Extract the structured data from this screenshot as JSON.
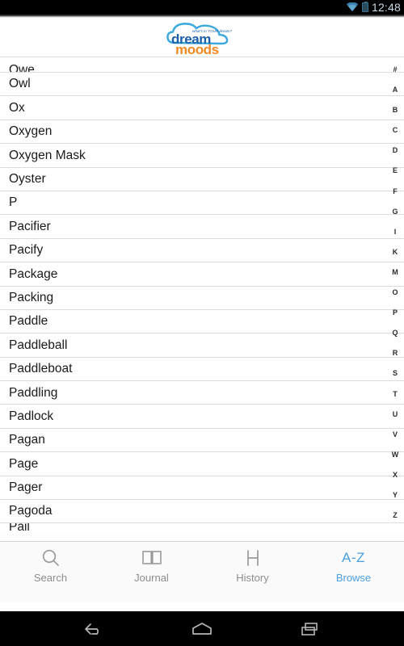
{
  "status_bar": {
    "time": "12:48",
    "wifi_icon": "wifi-icon",
    "battery_icon": "battery-icon"
  },
  "brand": {
    "tagline": "what's in YOUR dream?",
    "name_top": "dream",
    "name_bottom": "moods",
    "color_blue": "#1d5fa8",
    "color_orange": "#f08a24",
    "cloud_color": "#3ba9dd"
  },
  "list": {
    "items": [
      {
        "word": "Owe",
        "clipped": "top"
      },
      {
        "word": "Owl"
      },
      {
        "word": "Ox"
      },
      {
        "word": "Oxygen"
      },
      {
        "word": "Oxygen Mask"
      },
      {
        "word": "Oyster"
      },
      {
        "word": "P"
      },
      {
        "word": "Pacifier"
      },
      {
        "word": "Pacify"
      },
      {
        "word": "Package"
      },
      {
        "word": "Packing"
      },
      {
        "word": "Paddle"
      },
      {
        "word": "Paddleball"
      },
      {
        "word": "Paddleboat"
      },
      {
        "word": "Paddling"
      },
      {
        "word": "Padlock"
      },
      {
        "word": "Pagan"
      },
      {
        "word": "Page"
      },
      {
        "word": "Pager"
      },
      {
        "word": "Pagoda"
      },
      {
        "word": "Pail",
        "clipped": "bottom"
      }
    ]
  },
  "az_index": {
    "letters": [
      "#",
      "A",
      "B",
      "C",
      "D",
      "E",
      "F",
      "G",
      "I",
      "K",
      "M",
      "O",
      "P",
      "Q",
      "R",
      "S",
      "T",
      "U",
      "V",
      "W",
      "X",
      "Y",
      "Z"
    ]
  },
  "tabs": [
    {
      "label": "Search",
      "icon": "search-icon",
      "active": false
    },
    {
      "label": "Journal",
      "icon": "book-icon",
      "active": false
    },
    {
      "label": "History",
      "icon": "history-icon",
      "active": false
    },
    {
      "label": "Browse",
      "icon": "az-icon",
      "icon_text": "A-Z",
      "active": true
    }
  ],
  "nav_bar": {
    "back": "back-icon",
    "home": "home-icon",
    "recents": "recents-icon"
  },
  "colors": {
    "accent": "#4a9fe0",
    "tab_inactive": "#8d8d8d",
    "separator": "#dcdcdc",
    "background": "#ffffff"
  }
}
